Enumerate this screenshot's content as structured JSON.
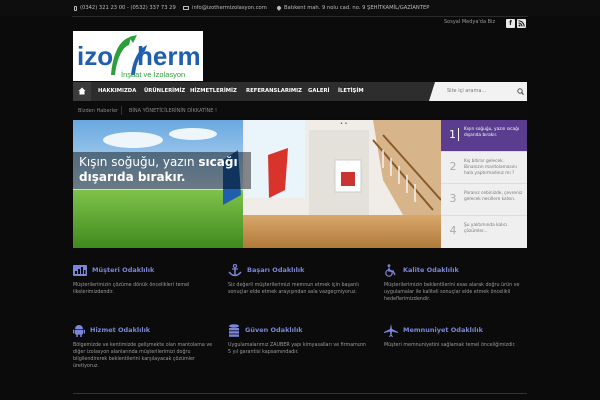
{
  "topbar": {
    "phones": "(0342) 321 23 00 - (0532) 337 73 29",
    "email": "info@izothermizolasyon.com",
    "address": "Batıkent mah. 9 nolu cad. no. 9 ŞEHİTKAMİL/GAZİANTEP"
  },
  "social": {
    "label": "Sosyal Medya'da Biz",
    "facebook": "f",
    "rss": "rss"
  },
  "logo": {
    "brand_left": "izo",
    "brand_right": "herm",
    "tagline": "İnşaat ve İzolasyon"
  },
  "nav": {
    "items": [
      "HAKKIMIZDA",
      "ÜRÜNLERİMİZ",
      "HİZMETLERİMİZ",
      "REFERANSLARIMIZ",
      "GALERİ",
      "İLETİŞİM"
    ],
    "search_placeholder": "Site içi arama..."
  },
  "breadcrumb": {
    "label": "Bizden Haberler",
    "item": "BİNA YÖNETİCİLERİNİN DİKKATİNE !"
  },
  "slider": {
    "caption_line1_light": "Kışın soğuğu, yazın",
    "caption_line1_bold": "sıcağı",
    "caption_line2_bold": "dışarıda bırakır.",
    "dots": "• •",
    "tabs": [
      {
        "num": "1",
        "text": "Kışın soğuğu, yazın sıcağı dışarıda bırakır."
      },
      {
        "num": "2",
        "text": "Kış bitirar gelecek. Binanızın mantolamasını hala yaptırmadınız mı ?"
      },
      {
        "num": "3",
        "text": "Paranız cebinizde, çevreniz gelecek nesillere kalsın."
      },
      {
        "num": "4",
        "text": "Şu yalıtımında kalıcı çözümler..."
      }
    ]
  },
  "features": [
    {
      "title": "Müşteri Odaklılık",
      "icon": "chart-icon",
      "desc": "Müşterilerimizin çözüme dönük öncelikleri temel ilkelerimizdendir."
    },
    {
      "title": "Başarı Odaklılık",
      "icon": "anchor-icon",
      "desc": "Siz değerli müşterilerimizi memnun etmek için başarılı sonuçlar elde etmek arayışından asla vazgeçmiyoruz."
    },
    {
      "title": "Kalite Odaklılık",
      "icon": "wheelchair-icon",
      "desc": "Müşterilerimizin beklentilerini esas alarak doğru ürün ve uygulamalar ile kaliteli sonuçlar elde etmek öncelikli hedeflerimizdendir."
    },
    {
      "title": "Hizmet Odaklılık",
      "icon": "android-icon",
      "desc": "Bölgemizde ve kentimizde gelişmekte olan mantolama ve diğer izolasyon alanlarında müşterilerimizi doğru bilgilendirerek beklentilerini karşılayacak çözümler üretiyoruz."
    },
    {
      "title": "Güven Odaklılık",
      "icon": "database-icon",
      "desc": "Uygulamalarımız ZAUBER yapı kimyasalları ve firmamızın 5 yıl garantisi kapsamındadır."
    },
    {
      "title": "Memnuniyet Odaklılık",
      "icon": "plane-icon",
      "desc": "Müşteri memnuniyetini sağlamak temel önceliğimizdir."
    }
  ],
  "colors": {
    "accent": "#5b3d8f",
    "feature_title": "#7b86d8",
    "nav_bg": "#2d2d2d"
  }
}
